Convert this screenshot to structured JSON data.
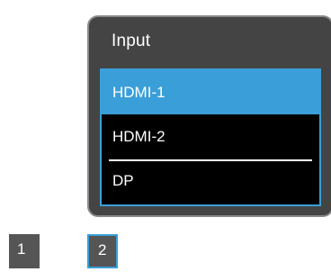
{
  "osd": {
    "title": "Input",
    "items": [
      {
        "label": "HDMI-1",
        "selected": true
      },
      {
        "label": "HDMI-2",
        "selected": false
      },
      {
        "label": "DP",
        "selected": false
      }
    ]
  },
  "pages": [
    {
      "label": "1",
      "active": false
    },
    {
      "label": "2",
      "active": true
    }
  ],
  "colors": {
    "accent": "#3a9fd8",
    "panel": "#444444",
    "list_bg": "#000000",
    "page_box": "#555555"
  }
}
